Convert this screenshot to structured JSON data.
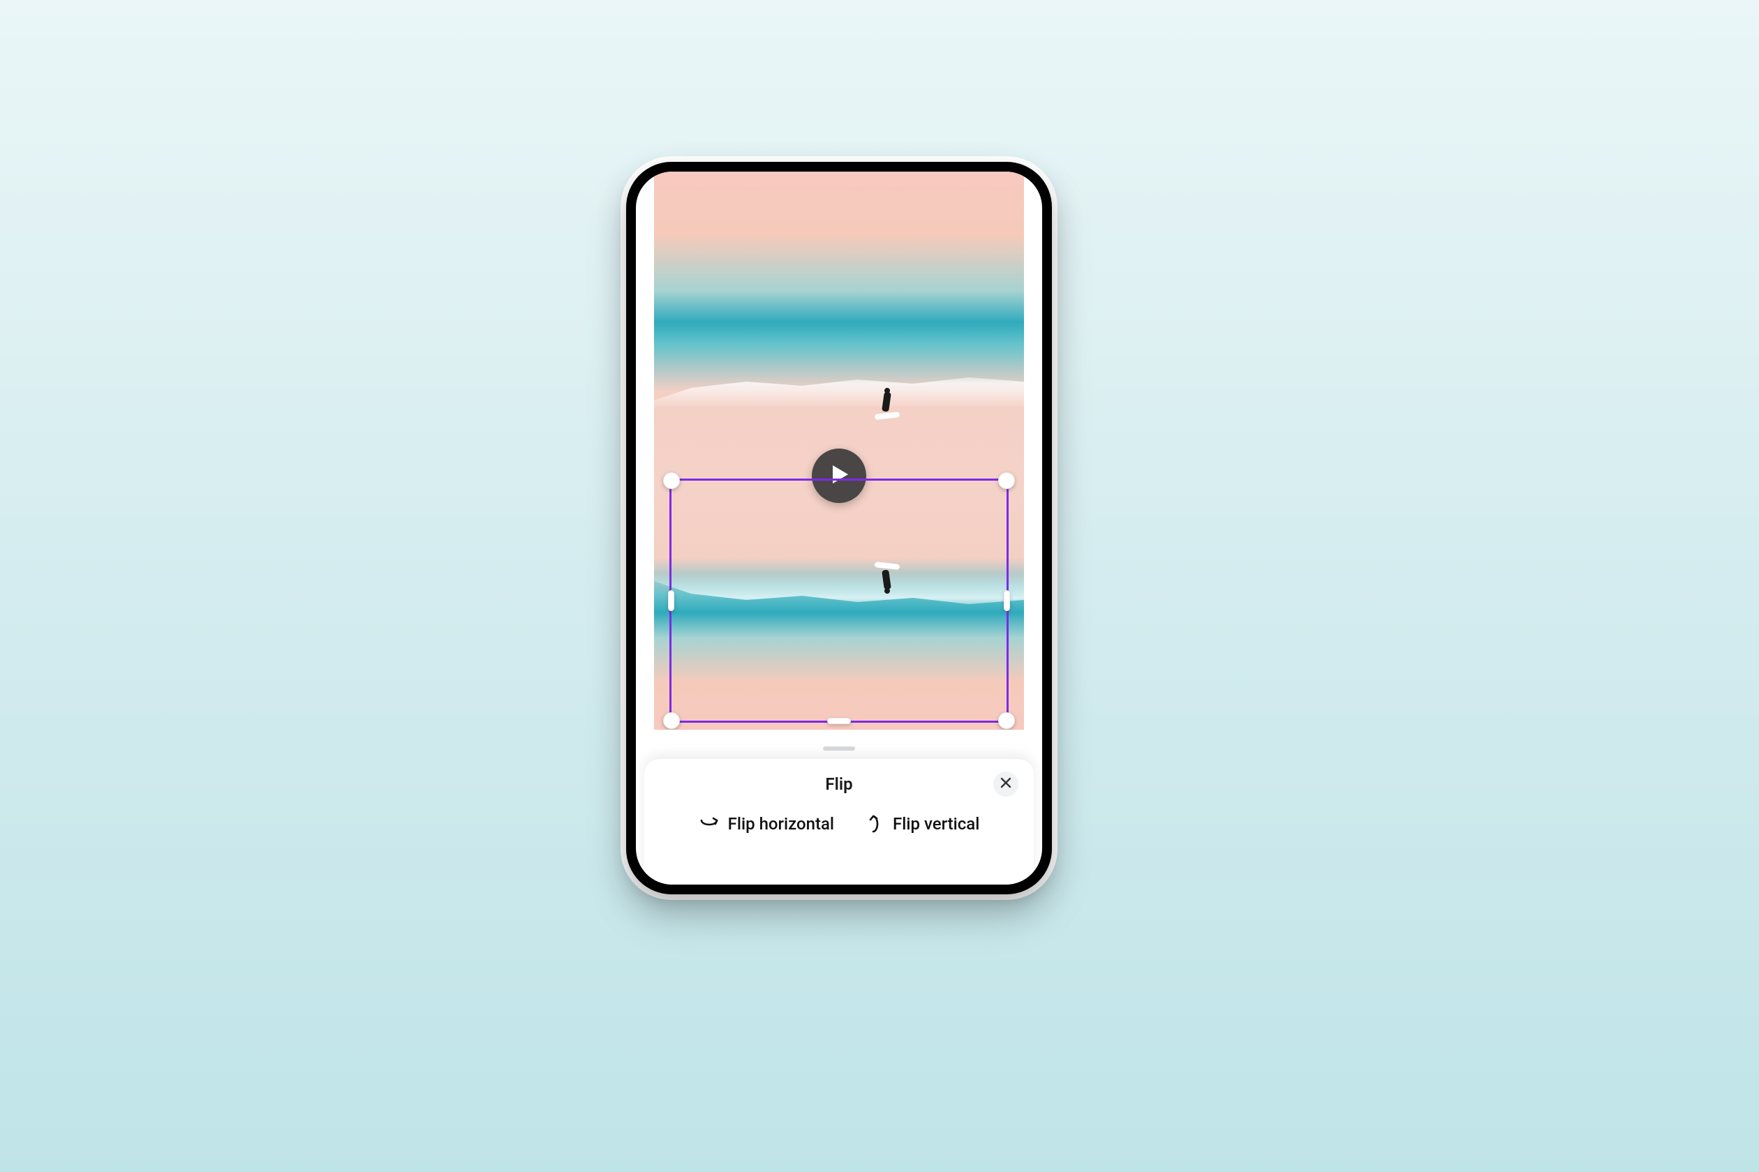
{
  "sheet": {
    "title": "Flip",
    "close_icon": "close",
    "actions": {
      "horizontal": {
        "label": "Flip horizontal",
        "icon": "flip-horizontal"
      },
      "vertical": {
        "label": "Flip vertical",
        "icon": "flip-vertical"
      }
    }
  },
  "canvas": {
    "play_icon": "play",
    "selection_color": "#7d2ae8"
  }
}
